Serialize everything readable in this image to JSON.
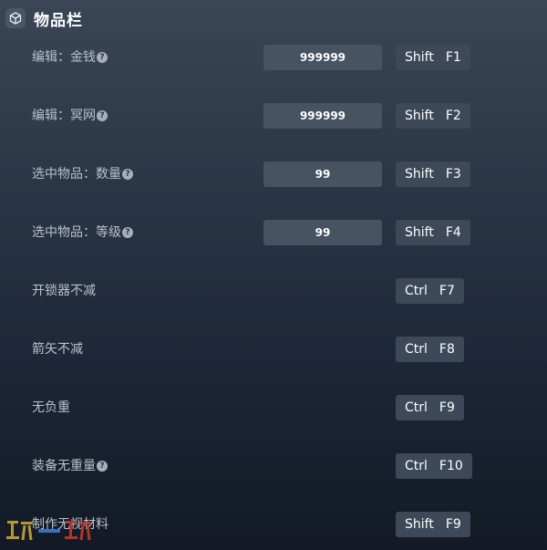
{
  "section": {
    "title": "物品栏",
    "icon": "cube-icon"
  },
  "rows": [
    {
      "label": "编辑：金钱",
      "help": true,
      "value": "999999",
      "key1": "Shift",
      "key2": "F1"
    },
    {
      "label": "编辑：冥网",
      "help": true,
      "value": "999999",
      "key1": "Shift",
      "key2": "F2"
    },
    {
      "label": "选中物品：数量",
      "help": true,
      "value": "99",
      "key1": "Shift",
      "key2": "F3"
    },
    {
      "label": "选中物品：等级",
      "help": true,
      "value": "99",
      "key1": "Shift",
      "key2": "F4"
    },
    {
      "label": "开锁器不减",
      "key1": "Ctrl",
      "key2": "F7"
    },
    {
      "label": "箭矢不减",
      "key1": "Ctrl",
      "key2": "F8"
    },
    {
      "label": "无负重",
      "key1": "Ctrl",
      "key2": "F9"
    },
    {
      "label": "装备无重量",
      "help": true,
      "key1": "Ctrl",
      "key2": "F10"
    },
    {
      "label": "制作无视材料",
      "key1": "Shift",
      "key2": "F9"
    }
  ],
  "help_glyph": "?",
  "watermark": {
    "colors": [
      "#c9a437",
      "#3d7bd6",
      "#c0392b"
    ]
  }
}
